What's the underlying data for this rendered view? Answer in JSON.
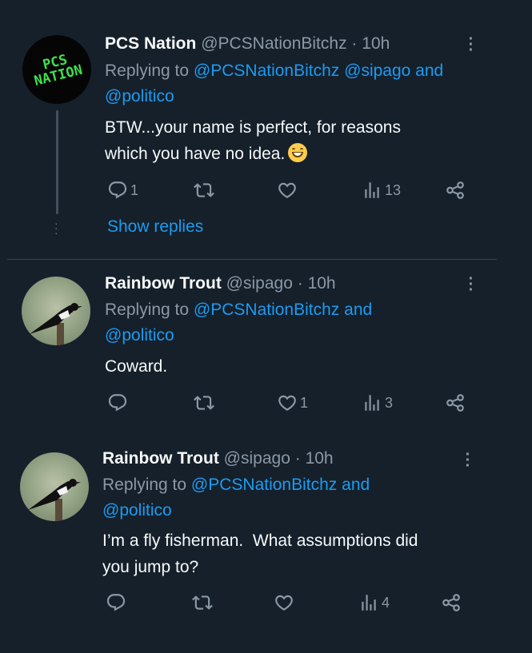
{
  "tweets": [
    {
      "name": "PCS Nation",
      "handle": "@PCSNationBitchz",
      "separator": "·",
      "time": "10h",
      "replying_prefix": "Replying to",
      "replying_mentions_line1": "@PCSNationBitchz @sipago",
      "replying_and": "and",
      "replying_mentions_line2": "@politico",
      "text_line1": "BTW...your name is perfect, for reasons",
      "text_line2": "which you have no idea.",
      "avatar_text_line1": "PCS",
      "avatar_text_line2": "NATION",
      "reply_count": "1",
      "retweet_count": "",
      "like_count": "",
      "views_count": "13",
      "show_replies": "Show replies"
    },
    {
      "name": "Rainbow Trout",
      "handle": "@sipago",
      "separator": "·",
      "time": "10h",
      "replying_prefix": "Replying to",
      "replying_mentions_line1": "@PCSNationBitchz",
      "replying_and": "and",
      "replying_mentions_line2": "@politico",
      "text_line1": "Coward.",
      "text_line2": "",
      "reply_count": "",
      "retweet_count": "",
      "like_count": "1",
      "views_count": "3"
    },
    {
      "name": "Rainbow Trout",
      "handle": "@sipago",
      "separator": "·",
      "time": "10h",
      "replying_prefix": "Replying to",
      "replying_mentions_line1": "@PCSNationBitchz",
      "replying_and": "and",
      "replying_mentions_line2": "@politico",
      "text_line1": "I’m a fly fisherman.  What assumptions did",
      "text_line2": "you jump to?",
      "reply_count": "",
      "retweet_count": "",
      "like_count": "",
      "views_count": "4"
    }
  ],
  "icons": {
    "reply": "reply-icon",
    "retweet": "retweet-icon",
    "like": "heart-icon",
    "views": "views-icon",
    "share": "share-icon",
    "more": "more-icon"
  },
  "colors": {
    "background": "#15202b",
    "accent": "#1d9bf0",
    "muted": "#8b98a5",
    "pcs_green": "#3fe04a"
  }
}
